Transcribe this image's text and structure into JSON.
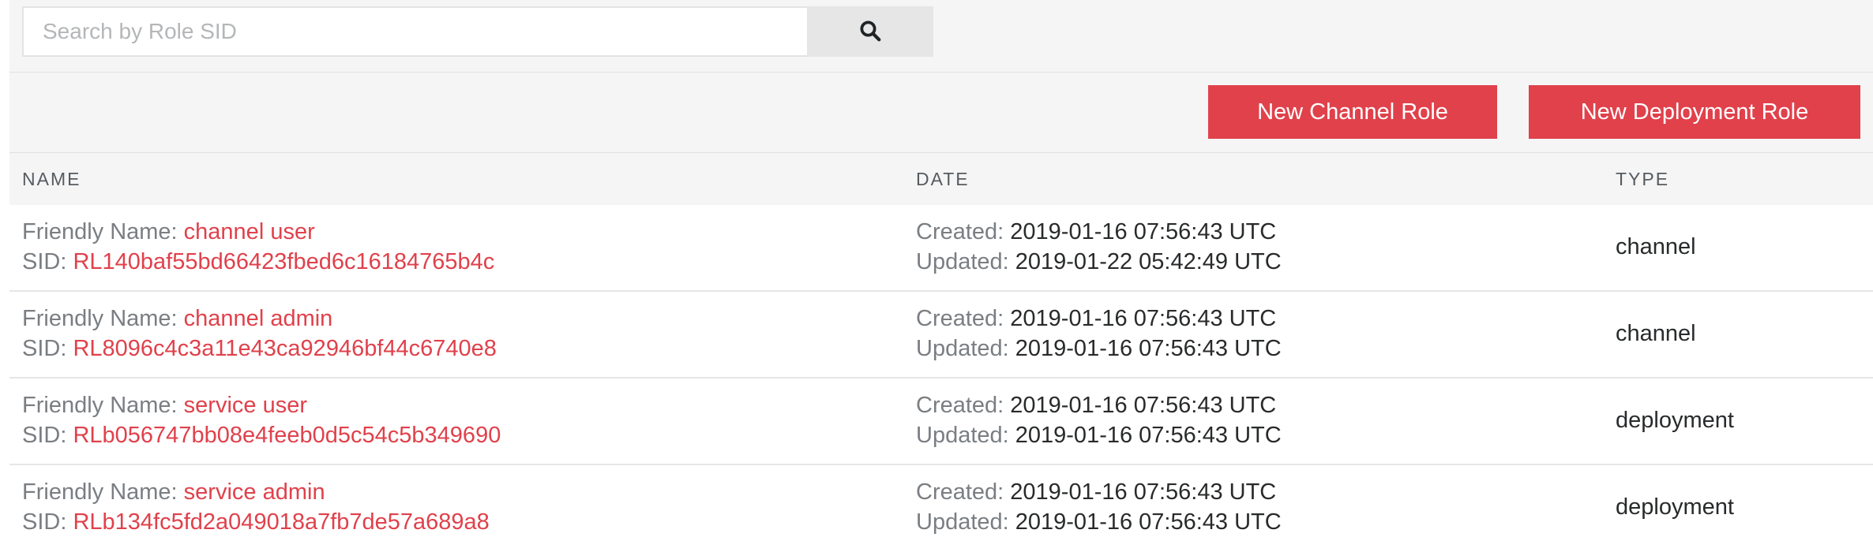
{
  "search": {
    "placeholder": "Search by Role SID",
    "value": ""
  },
  "actions": {
    "new_channel_role": "New Channel Role",
    "new_deployment_role": "New Deployment Role"
  },
  "table": {
    "headers": {
      "name": "NAME",
      "date": "DATE",
      "type": "TYPE"
    },
    "labels": {
      "friendly_name": "Friendly Name: ",
      "sid": "SID: ",
      "created": "Created: ",
      "updated": "Updated: "
    },
    "rows": [
      {
        "friendly_name": "channel user",
        "sid": "RL140baf55bd66423fbed6c16184765b4c",
        "created": "2019-01-16 07:56:43 UTC",
        "updated": "2019-01-22 05:42:49 UTC",
        "type": "channel"
      },
      {
        "friendly_name": "channel admin",
        "sid": "RL8096c4c3a11e43ca92946bf44c6740e8",
        "created": "2019-01-16 07:56:43 UTC",
        "updated": "2019-01-16 07:56:43 UTC",
        "type": "channel"
      },
      {
        "friendly_name": "service user",
        "sid": "RLb056747bb08e4feeb0d5c54c5b349690",
        "created": "2019-01-16 07:56:43 UTC",
        "updated": "2019-01-16 07:56:43 UTC",
        "type": "deployment"
      },
      {
        "friendly_name": "service admin",
        "sid": "RLb134fc5fd2a049018a7fb7de57a689a8",
        "created": "2019-01-16 07:56:43 UTC",
        "updated": "2019-01-16 07:56:43 UTC",
        "type": "deployment"
      }
    ]
  },
  "icons": {
    "search": "search-icon"
  },
  "colors": {
    "accent": "#e0414b",
    "toolbar_bg": "#f5f5f5"
  }
}
